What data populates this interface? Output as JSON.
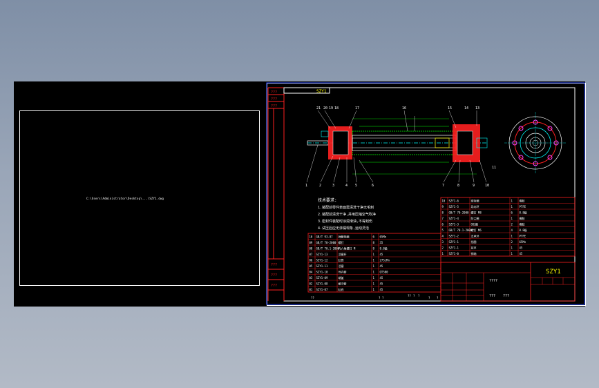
{
  "viewport": {
    "background": "#000000"
  },
  "left_sheet": {
    "path": "C:\\Users\\Administrator\\Desktop\\...\\SZY1.dwg"
  },
  "drawing": {
    "title_box": "SZY1",
    "left_labels": [
      "???",
      "???",
      "???"
    ],
    "side_labels_bottom": [
      "???",
      "???",
      "???"
    ],
    "notes_title": "技术要求:",
    "notes": [
      "1.装配前零件表面需清洗干净无毛刺",
      "2.装配前清洗干净,并用压缩空气吹净",
      "3.密封件装配时涂润滑油,不得划伤",
      "4.试压后应无渗漏现象,运动灵活"
    ],
    "callouts_top": [
      "21",
      "20",
      "19",
      "18",
      "17",
      "16",
      "15",
      "14",
      "13"
    ],
    "callouts_bottom": [
      "1",
      "2",
      "3",
      "4",
      "5",
      "6",
      "7",
      "8",
      "9",
      "10",
      "11"
    ],
    "bom_left": [
      [
        "10",
        "GB/T 93-87",
        "弹簧垫圈",
        "6",
        "65Mn"
      ],
      [
        "09",
        "GB/T 70-2000",
        "螺钉",
        "8",
        "35"
      ],
      [
        "08",
        "GB/T 70.1-2000",
        "内六角螺钉 M",
        "8",
        "8.8级"
      ],
      [
        "07",
        "SZY1-13",
        "活塞杆",
        "1",
        "45"
      ],
      [
        "06",
        "SZY1-12",
        "缸筒",
        "1",
        "27SiMn"
      ],
      [
        "05",
        "SZY1-11",
        "活塞",
        "1",
        "45"
      ],
      [
        "04",
        "SZY1-10",
        "导向套",
        "1",
        "QT500"
      ],
      [
        "03",
        "SZY1-09",
        "端盖",
        "1",
        "45"
      ],
      [
        "02",
        "SZY1-08",
        "缓冲套",
        "1",
        "45"
      ],
      [
        "01",
        "SZY1-07",
        "缸底",
        "1",
        "45"
      ]
    ],
    "bom_right": [
      [
        "10",
        "SZY1-6",
        "密封圈",
        "1",
        "橡胶"
      ],
      [
        "9",
        "SZY1-5",
        "导向环",
        "1",
        "PTFE"
      ],
      [
        "8",
        "GB/T 70-2000",
        "螺钉 M8",
        "6",
        "8.8级"
      ],
      [
        "7",
        "SZY1-4",
        "防尘圈",
        "1",
        "橡胶"
      ],
      [
        "6",
        "SZY1-3",
        "O形圈",
        "2",
        "橡胶"
      ],
      [
        "5",
        "GB/T 70.1-2000",
        "螺钉 M6",
        "4",
        "8.8级"
      ],
      [
        "4",
        "SZY1-2",
        "支承环",
        "1",
        "PTFE"
      ],
      [
        "3",
        "SZY1-1",
        "挡圈",
        "2",
        "65Mn"
      ],
      [
        "2",
        "SZY1-1",
        "耳环",
        "1",
        "45"
      ],
      [
        "1",
        "SZY1-0",
        "销轴",
        "1",
        "45"
      ]
    ],
    "title_block_main": "SZY1",
    "title_block_labels": [
      "????",
      "???",
      "???"
    ],
    "footer_marks": [
      "??",
      "?",
      "?",
      "??",
      "?",
      "?",
      "?",
      "?"
    ]
  },
  "colors": {
    "line": "#ffffff",
    "red": "#ff2020",
    "green": "#00ff00",
    "yellow": "#ffff00",
    "cyan": "#00ffff",
    "magenta": "#ff40ff",
    "blue": "#3050ff"
  }
}
